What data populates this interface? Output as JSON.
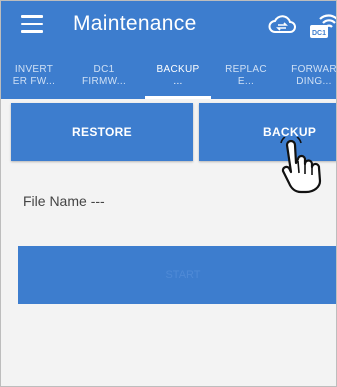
{
  "header": {
    "title": "Maintenance",
    "cloud_icon": "cloud-sync-icon",
    "device_icon": "dc-wifi-icon",
    "device_badge": "DC1"
  },
  "tabs": [
    {
      "line1": "INVERT",
      "line2": "ER FW...",
      "active": false
    },
    {
      "line1": "DC1",
      "line2": "FIRMW...",
      "active": false
    },
    {
      "line1": "BACKUP",
      "line2": "...",
      "active": true
    },
    {
      "line1": "REPLAC",
      "line2": "E...",
      "active": false
    },
    {
      "line1": "FORWAR",
      "line2": "DING...",
      "active": false
    }
  ],
  "actions": {
    "restore_label": "RESTORE",
    "backup_label": "BACKUP"
  },
  "file": {
    "label": "File Name",
    "value": "---"
  },
  "start_label": "START",
  "colors": {
    "primary": "#3d7dce",
    "background": "#f3f3f3"
  }
}
